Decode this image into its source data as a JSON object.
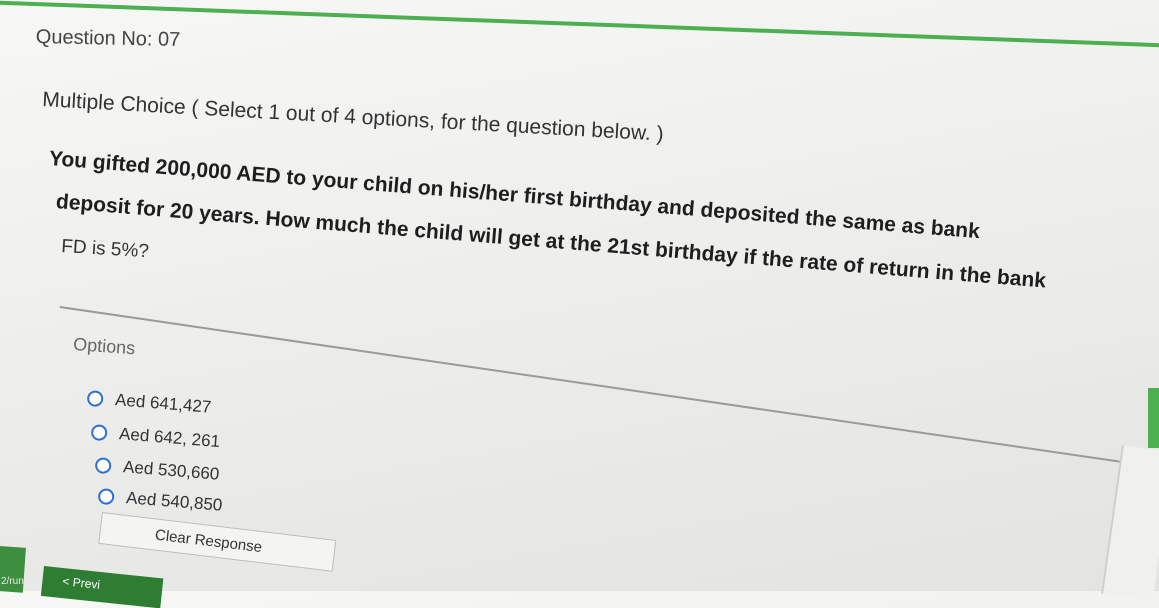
{
  "question": {
    "number_label": "Question No: 07",
    "type_label": "Multiple Choice ( Select 1 out of 4 options, for the question below. )",
    "text_lines": [
      "You gifted 200,000 AED to your child on his/her first birthday and deposited the same as bank",
      "deposit for 20 years. How much the child will get at the 21st birthday if the rate of return in the bank",
      "FD is 5%?"
    ]
  },
  "options_section": {
    "label": "Options",
    "options": [
      {
        "label": "Aed 641,427",
        "selected": false
      },
      {
        "label": "Aed 642, 261",
        "selected": false
      },
      {
        "label": "Aed 530,660",
        "selected": false
      },
      {
        "label": "Aed 540,850",
        "selected": false
      }
    ]
  },
  "buttons": {
    "clear_response": "Clear Response",
    "previous": "< Previ"
  },
  "left_edge_text": "2/run",
  "colors": {
    "accent_green": "#4caf50",
    "radio_blue": "#2f6fcf"
  }
}
